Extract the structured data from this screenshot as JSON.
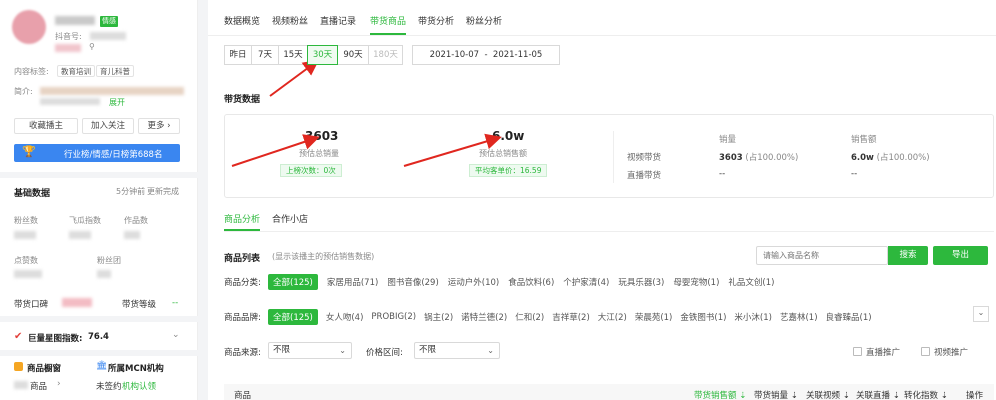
{
  "profile": {
    "badge": "情感",
    "douyin_label": "抖音号:",
    "content_tag_label": "内容标签:",
    "content_tags": [
      "教育培训",
      "育儿科普"
    ],
    "intro_label": "简介:",
    "expand_label": "展开",
    "buttons": {
      "collect": "收藏播主",
      "follow": "加入关注",
      "more": "更多"
    },
    "rank_banner": "行业榜/情感/日榜第688名"
  },
  "basic": {
    "title": "基础数据",
    "updated": "5分钟前",
    "refresh": "更新完成",
    "stats": [
      {
        "label": "粉丝数"
      },
      {
        "label": "飞瓜指数"
      },
      {
        "label": "作品数"
      },
      {
        "label": "点赞数"
      },
      {
        "label": "粉丝团"
      }
    ],
    "shop_label": "带货口碑",
    "level_label": "带货等级",
    "level_value": "--"
  },
  "star_index": {
    "label": "巨量星图指数:",
    "value": "76.4"
  },
  "shop": {
    "window_label": "商品橱窗",
    "window_sub": "商品",
    "mcn_label": "所属MCN机构",
    "mcn_status": "未签约",
    "mcn_auth": "机构认领"
  },
  "tabs": [
    "数据概览",
    "视频粉丝",
    "直播记录",
    "带货商品",
    "带货分析",
    "粉丝分析"
  ],
  "active_tab": 3,
  "period": {
    "options": [
      "昨日",
      "7天",
      "15天",
      "30天",
      "90天",
      "180天"
    ],
    "selected": 3,
    "disabled": 5,
    "date_range": "2021-10-07  -  2021-11-05"
  },
  "summary": {
    "title": "带货数据",
    "sales_value": "3603",
    "sales_label": "预估总销量",
    "sales_chip": "上榜次数：0次",
    "revenue_value": "6.0w",
    "revenue_label": "预估总销售额",
    "revenue_chip": "平均客单价：16.59",
    "table": {
      "headers": [
        "销量",
        "销售额"
      ],
      "rows": [
        {
          "label": "视频带货",
          "sales": "3603",
          "sales_pct": "(占100.00%)",
          "rev": "6.0w",
          "rev_pct": "(占100.00%)"
        },
        {
          "label": "直播带货",
          "sales": "--",
          "sales_pct": "",
          "rev": "--",
          "rev_pct": ""
        }
      ]
    }
  },
  "subtabs": [
    "商品分析",
    "合作小店"
  ],
  "goods": {
    "title": "商品列表",
    "hint": "(显示该播主的预估销售数据)",
    "search_placeholder": "请输入商品名称",
    "search_btn": "搜索",
    "export_btn": "导出",
    "category_label": "商品分类:",
    "categories": [
      "全部(125)",
      "家居用品(71)",
      "图书音像(29)",
      "运动户外(10)",
      "食品饮料(6)",
      "个护家清(4)",
      "玩具乐器(3)",
      "母婴宠物(1)",
      "礼品文创(1)"
    ],
    "brand_label": "商品品牌:",
    "brands": [
      "全部(125)",
      "女人吻(4)",
      "PROBIG(2)",
      "锅主(2)",
      "诺特兰德(2)",
      "仁和(2)",
      "吉祥草(2)",
      "大江(2)",
      "荣晨苑(1)",
      "金铁图书(1)",
      "米小沐(1)",
      "艺嘉林(1)",
      "良睿臻品(1)"
    ],
    "source_label": "商品来源:",
    "source_value": "不限",
    "price_label": "价格区间:",
    "price_value": "不限",
    "live_promo": "直播推广",
    "video_promo": "视频推广",
    "columns": [
      "商品",
      "带货销售额",
      "带货销量",
      "关联视频",
      "关联直播",
      "转化指数",
      "操作"
    ]
  }
}
